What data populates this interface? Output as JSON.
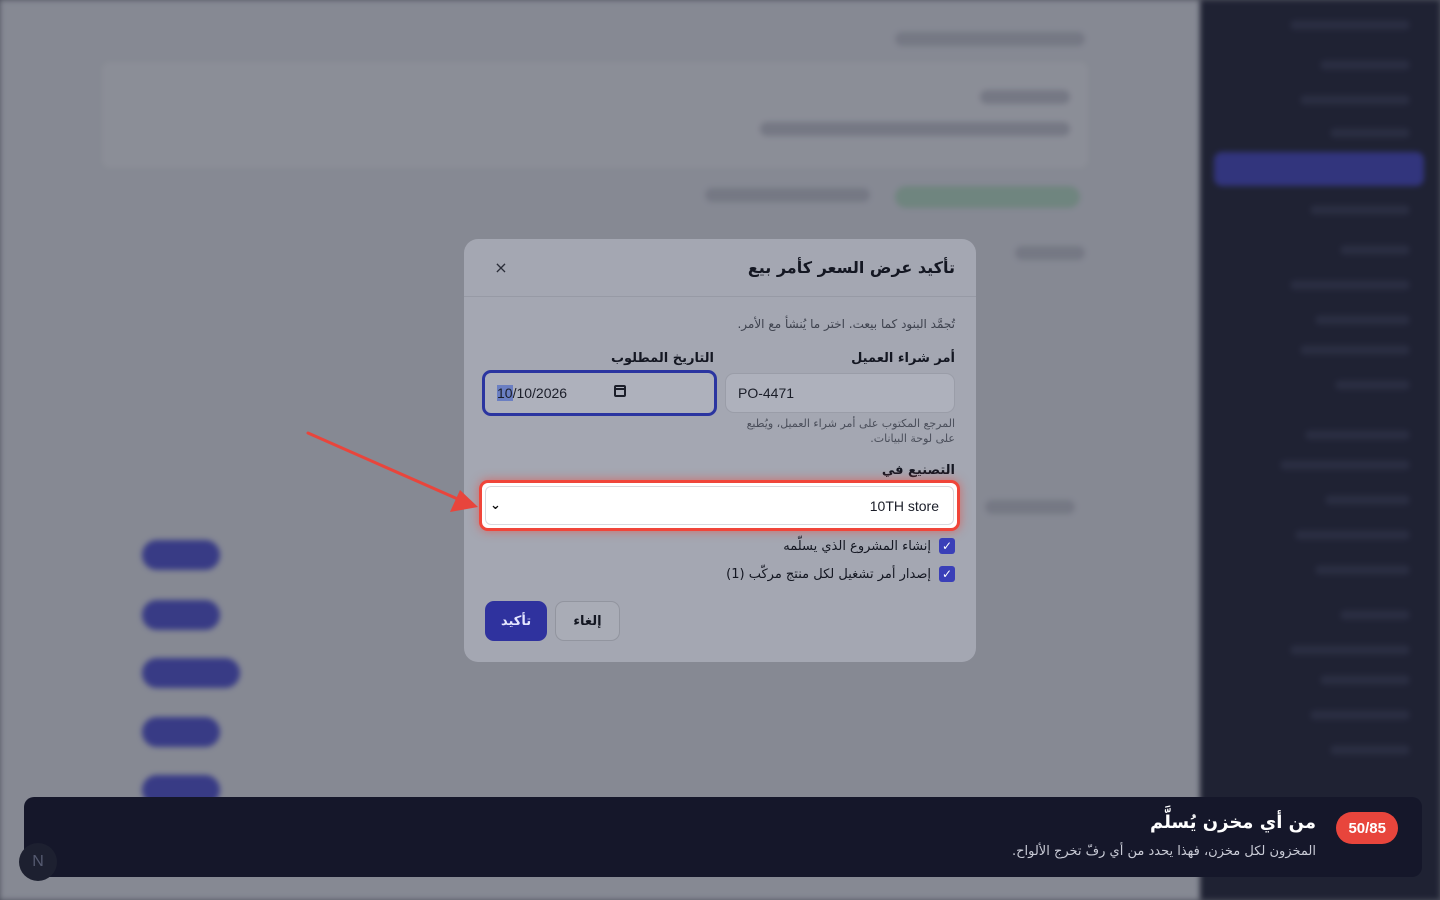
{
  "modal": {
    "title": "تأكيد عرض السعر كأمر بيع",
    "close_icon": "×",
    "description": "تُجمَّد البنود كما بيعت. اختر ما يُنشأ مع الأمر.",
    "po_label": "أمر شراء العميل",
    "po_value": "PO-4471",
    "po_helper": "المرجع المكتوب على أمر شراء العميل، ويُطبع على لوحة البيانات.",
    "date_label": "التاريخ المطلوب",
    "date_value": "10/10/2026",
    "date_month": "10",
    "date_rest": "/10/2026",
    "manufacture_label": "التصنيع في",
    "manufacture_value": "10TH store",
    "chevron_icon": "⌄",
    "check_project": "إنشاء المشروع الذي يسلّمه",
    "check_work_order": "إصدار أمر تشغيل لكل منتج مركّب (1)",
    "confirm_label": "تأكيد",
    "cancel_label": "إلغاء"
  },
  "tour": {
    "badge": "50/85",
    "title": "من أي مخزن يُسلَّم",
    "text": "المخزون لكل مخزن، فهذا يحدد من أي رفّ تخرج الألواح."
  },
  "avatar": {
    "initial": "N"
  },
  "colors": {
    "accent": "#2f329e",
    "highlight": "#f0453a",
    "sidebar": "#15172a",
    "badge": "#e8453c"
  }
}
